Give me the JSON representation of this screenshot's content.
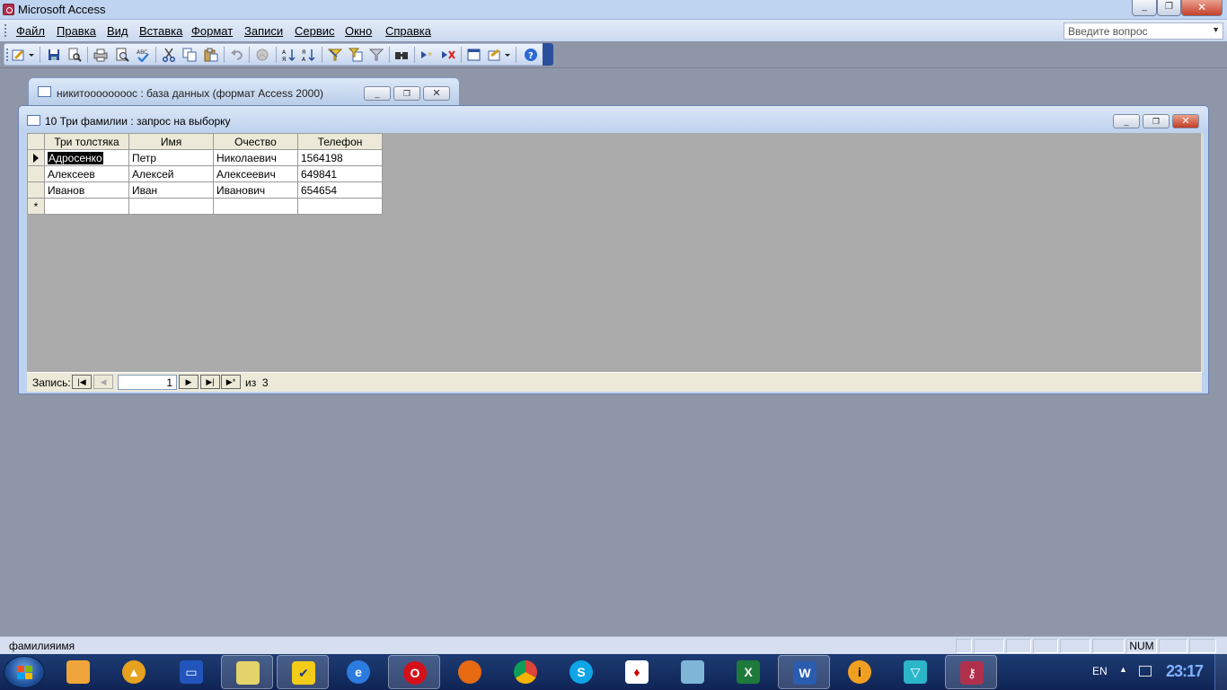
{
  "app": {
    "title": "Microsoft Access",
    "controls": {
      "minimize": "_",
      "maximize": "❐",
      "close": "✕"
    }
  },
  "menu": {
    "items": [
      "Файл",
      "Правка",
      "Вид",
      "Вставка",
      "Формат",
      "Записи",
      "Сервис",
      "Окно",
      "Справка"
    ],
    "ask_placeholder": "Введите вопрос"
  },
  "toolbar": {
    "icons": [
      "view-icon",
      "save-icon",
      "search-icon",
      "print-icon",
      "print-preview-icon",
      "spelling-icon",
      "cut-icon",
      "copy-icon",
      "paste-icon",
      "undo-icon",
      "hyperlink-icon",
      "sort-ascending-icon",
      "sort-descending-icon",
      "filter-by-selection-icon",
      "filter-by-form-icon",
      "apply-filter-icon",
      "find-icon",
      "new-record-icon",
      "delete-record-icon",
      "database-window-icon",
      "new-object-icon",
      "help-icon"
    ]
  },
  "db_window": {
    "title": "никитоооооооос : база данных (формат Access 2000)"
  },
  "query_window": {
    "title": "10 Три фамилии : запрос на выборку",
    "columns": [
      "Три толстяка",
      "Имя",
      "Очество",
      "Телефон"
    ],
    "rows": [
      [
        "Адросенко",
        "Петр",
        "Николаевич",
        "1564198"
      ],
      [
        "Алексеев",
        "Алексей",
        "Алексеевич",
        "649841"
      ],
      [
        "Иванов",
        "Иван",
        "Иванович",
        "654654"
      ]
    ],
    "new_row_marker": "*",
    "navigator": {
      "label": "Запись:",
      "current": "1",
      "of_label": "из",
      "total": "3"
    }
  },
  "status": {
    "text": "фамилияимя",
    "num": "NUM"
  },
  "taskbar": {
    "language": "EN",
    "clock": "23:17"
  },
  "colors": {
    "workspace": "#8f96a8",
    "datasheet_bg": "#ababab",
    "title_bar": "#bfd4f0"
  }
}
